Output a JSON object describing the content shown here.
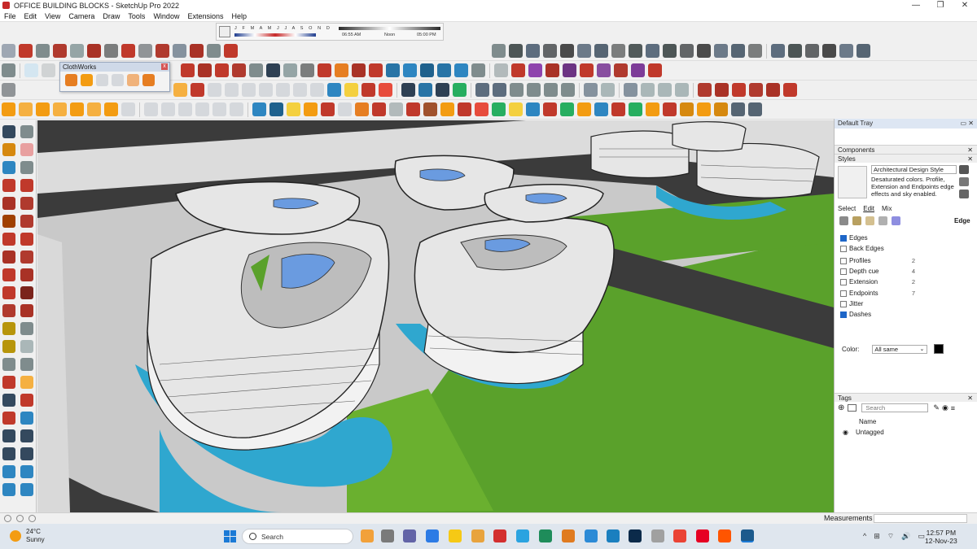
{
  "window": {
    "title": "OFFICE BUILDING BLOCKS - SketchUp Pro 2022",
    "controls": [
      "—",
      "❐",
      "✕"
    ]
  },
  "menu": [
    "File",
    "Edit",
    "View",
    "Camera",
    "Draw",
    "Tools",
    "Window",
    "Extensions",
    "Help"
  ],
  "shadow_settings": {
    "months": "J F M A M J J A S O N D",
    "time_start": "06:55 AM",
    "time_mid": "Noon",
    "time_end": "05:00 PM"
  },
  "clothworks": {
    "title": "ClothWorks",
    "close": "x"
  },
  "tray": {
    "title": "Default Tray",
    "pin": "▭ ✕",
    "components": {
      "label": "Components",
      "close": "✕"
    },
    "styles": {
      "label": "Styles",
      "close": "✕",
      "style_name": "Architectural Design Style",
      "description": "Desaturated colors. Profile, Extension and Endpoints edge effects and sky enabled.",
      "tabs": [
        "Select",
        "Edit",
        "Mix"
      ],
      "edge_heading": "Edge",
      "options": [
        {
          "label": "Edges",
          "checked": true,
          "value": ""
        },
        {
          "label": "Back Edges",
          "checked": false,
          "value": ""
        },
        {
          "label": "Profiles",
          "checked": false,
          "value": "2"
        },
        {
          "label": "Depth cue",
          "checked": false,
          "value": "4"
        },
        {
          "label": "Extension",
          "checked": false,
          "value": "2"
        },
        {
          "label": "Endpoints",
          "checked": false,
          "value": "7"
        },
        {
          "label": "Jitter",
          "checked": false,
          "value": ""
        },
        {
          "label": "Dashes",
          "checked": true,
          "value": ""
        }
      ],
      "color_label": "Color:",
      "color_value": "All same",
      "color_swatch": "#000000"
    },
    "tags": {
      "label": "Tags",
      "close": "✕",
      "search_placeholder": "Search",
      "column_name": "Name",
      "rows": [
        "Untagged"
      ]
    }
  },
  "status": {
    "measurements_label": "Measurements"
  },
  "taskbar": {
    "weather_temp": "24°C",
    "weather_desc": "Sunny",
    "search_label": "Search",
    "time": "12:57 PM",
    "date": "12-Nov-23",
    "sys_icons": [
      "^",
      "⊞",
      "⌔",
      "🔊",
      "▭"
    ]
  },
  "colors": {
    "accent": "#1b7ad6",
    "grass": "#5aa12b",
    "water": "#2fa7cf",
    "pavement": "#c9c9c9",
    "road": "#3b3b3b"
  }
}
